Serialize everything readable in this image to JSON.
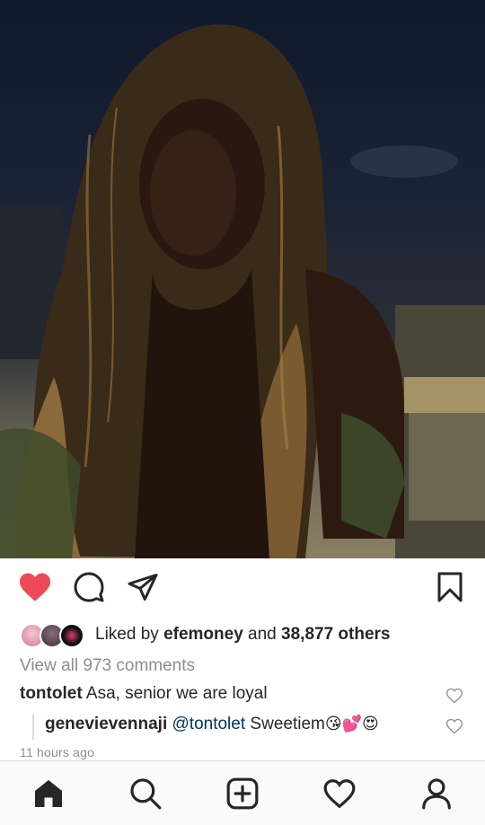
{
  "post": {
    "likes": {
      "prefix": "Liked by",
      "user": "efemoney",
      "joiner": "and",
      "count": "38,877 others"
    },
    "view_all_comments": "View all 973 comments",
    "comments": [
      {
        "user": "tontolet",
        "text": "Asa, senior we are loyal"
      },
      {
        "user": "genevievennaji",
        "mention": "@tontolet",
        "text": "Sweetiem",
        "emojis": "😘💕😍"
      }
    ],
    "timestamp": "11 hours ago"
  },
  "colors": {
    "like_red": "#ed4956",
    "text": "#262626",
    "secondary": "#8e8e8e",
    "mention": "#003569"
  },
  "icons": {
    "actions": [
      "heart-filled-icon",
      "comment-icon",
      "share-icon",
      "bookmark-icon"
    ],
    "tabs": [
      "home-icon",
      "search-icon",
      "new-post-icon",
      "activity-icon",
      "profile-icon"
    ]
  }
}
